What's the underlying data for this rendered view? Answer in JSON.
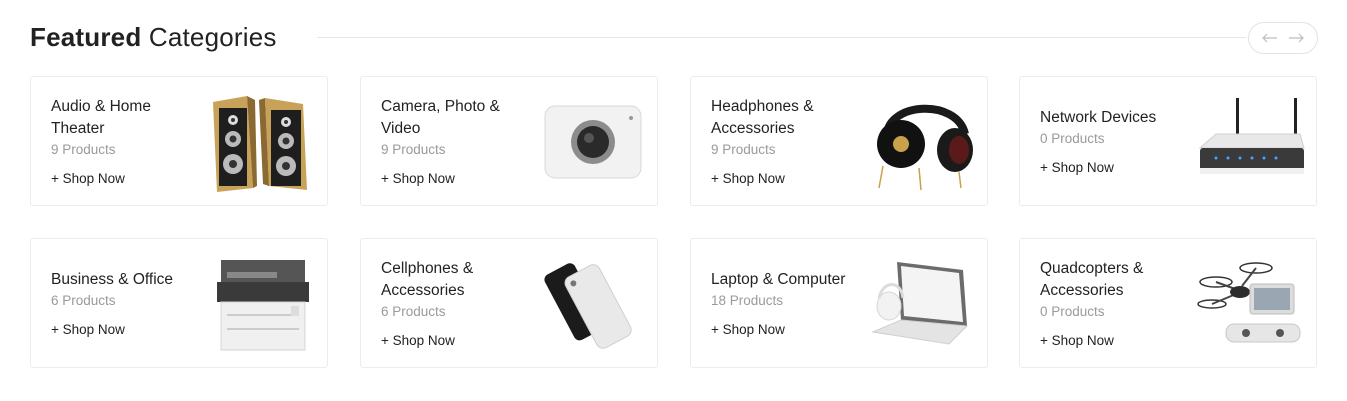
{
  "section": {
    "title_bold": "Featured",
    "title_light": "Categories",
    "prev_icon": "arrow-left-icon",
    "next_icon": "arrow-right-icon"
  },
  "categories": [
    {
      "name": "Audio & Home Theater",
      "count": "9 Products",
      "shop": "+ Shop Now",
      "icon": "speakers-image"
    },
    {
      "name": "Camera, Photo & Video",
      "count": "9 Products",
      "shop": "+ Shop Now",
      "icon": "action-camera-image"
    },
    {
      "name": "Headphones & Accessories",
      "count": "9 Products",
      "shop": "+ Shop Now",
      "icon": "headphones-image"
    },
    {
      "name": "Network Devices",
      "count": "0 Products",
      "shop": "+ Shop Now",
      "icon": "router-image"
    },
    {
      "name": "Business & Office",
      "count": "6 Products",
      "shop": "+ Shop Now",
      "icon": "printer-image"
    },
    {
      "name": "Cellphones & Accessories",
      "count": "6 Products",
      "shop": "+ Shop Now",
      "icon": "smartphone-image"
    },
    {
      "name": "Laptop & Computer",
      "count": "18 Products",
      "shop": "+ Shop Now",
      "icon": "laptop-image"
    },
    {
      "name": "Quadcopters & Accessories",
      "count": "0 Products",
      "shop": "+ Shop Now",
      "icon": "drone-image"
    }
  ]
}
